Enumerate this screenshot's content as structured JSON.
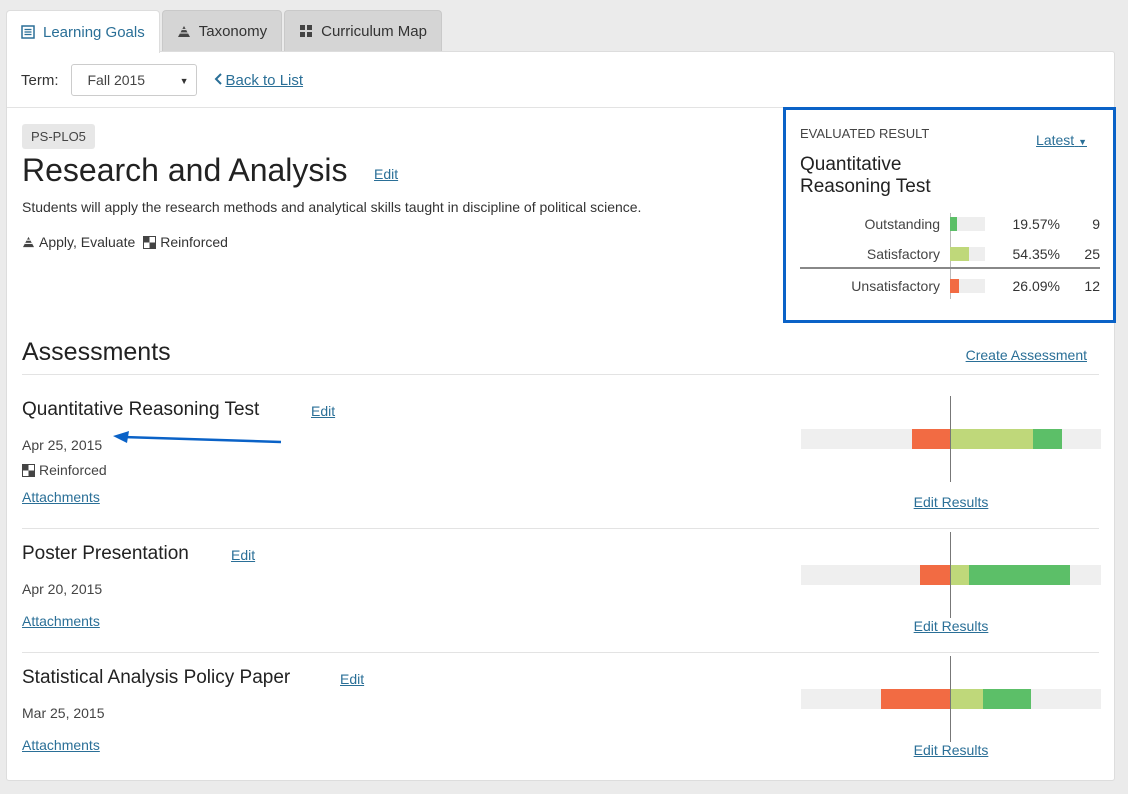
{
  "colors": {
    "link": "#2a6f97",
    "outstanding": "#5cbf68",
    "satisfactory": "#bfd87a",
    "unsatisfactory": "#f26b43",
    "highlight": "#0a62c7"
  },
  "tabs": [
    {
      "label": "Learning Goals",
      "icon": "list-icon",
      "active": true
    },
    {
      "label": "Taxonomy",
      "icon": "pyramid-icon",
      "active": false
    },
    {
      "label": "Curriculum Map",
      "icon": "grid-icon",
      "active": false
    }
  ],
  "toolbar": {
    "term_label": "Term:",
    "term_value": "Fall 2015",
    "back_label": "Back to List"
  },
  "goal": {
    "code": "PS-PLO5",
    "title": "Research and Analysis",
    "edit_label": "Edit",
    "description": "Students will apply the research methods and analytical skills taught in discipline of political science.",
    "taxonomy": "Apply, Evaluate",
    "level": "Reinforced"
  },
  "evaluated": {
    "heading": "EVALUATED RESULT",
    "latest_label": "Latest",
    "assessment_name": "Quantitative Reasoning Test",
    "rows": [
      {
        "label": "Outstanding",
        "pct_text": "19.57%",
        "pct": 19.57,
        "count": "9",
        "color_key": "outstanding"
      },
      {
        "label": "Satisfactory",
        "pct_text": "54.35%",
        "pct": 54.35,
        "count": "25",
        "color_key": "satisfactory"
      },
      {
        "label": "Unsatisfactory",
        "pct_text": "26.09%",
        "pct": 26.09,
        "count": "12",
        "color_key": "unsatisfactory"
      }
    ]
  },
  "assessments_section": {
    "title": "Assessments",
    "create_label": "Create Assessment"
  },
  "assessments": [
    {
      "name": "Quantitative Reasoning Test",
      "edit_label": "Edit",
      "date": "Apr 25, 2015",
      "level": "Reinforced",
      "attachments_label": "Attachments",
      "edit_results_label": "Edit Results",
      "results": {
        "unsatisfactory": 26.09,
        "satisfactory": 54.35,
        "outstanding": 19.57
      }
    },
    {
      "name": "Poster Presentation",
      "edit_label": "Edit",
      "date": "Apr 20, 2015",
      "level": "",
      "attachments_label": "Attachments",
      "edit_results_label": "Edit Results",
      "results": {
        "unsatisfactory": 21,
        "satisfactory": 12,
        "outstanding": 67
      }
    },
    {
      "name": "Statistical Analysis Policy Paper",
      "edit_label": "Edit",
      "date": "Mar 25, 2015",
      "level": "",
      "attachments_label": "Attachments",
      "edit_results_label": "Edit Results",
      "results": {
        "unsatisfactory": 47,
        "satisfactory": 21,
        "outstanding": 32
      }
    }
  ]
}
